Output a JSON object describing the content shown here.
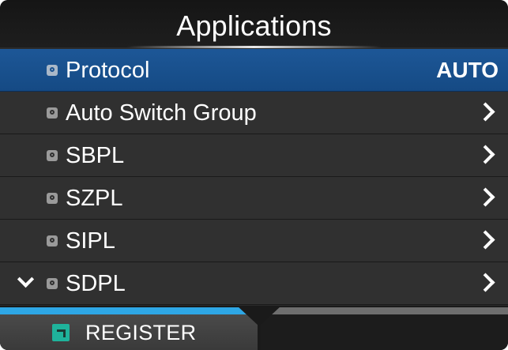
{
  "header": {
    "title": "Applications"
  },
  "menu": {
    "items": [
      {
        "label": "Protocol",
        "value": "AUTO",
        "selected": true,
        "icon": "lock-icon"
      },
      {
        "label": "Auto Switch Group",
        "value": "",
        "icon": "lock-icon",
        "arrow": "chevron-right-icon"
      },
      {
        "label": "SBPL",
        "value": "",
        "icon": "lock-icon",
        "arrow": "chevron-right-icon"
      },
      {
        "label": "SZPL",
        "value": "",
        "icon": "lock-icon",
        "arrow": "chevron-right-icon"
      },
      {
        "label": "SIPL",
        "value": "",
        "icon": "lock-icon",
        "arrow": "chevron-right-icon"
      },
      {
        "label": "SDPL",
        "value": "",
        "icon": "lock-icon",
        "arrow": "chevron-right-icon",
        "more_below": true
      }
    ]
  },
  "footer": {
    "register_label": "REGISTER",
    "register_icon": "register-icon"
  },
  "colors": {
    "selected_row": "#1d5797",
    "active_tab_indicator": "#2ea7e6",
    "inactive_tab_indicator": "#6e6e6e",
    "register_icon": "#1fb39b"
  }
}
